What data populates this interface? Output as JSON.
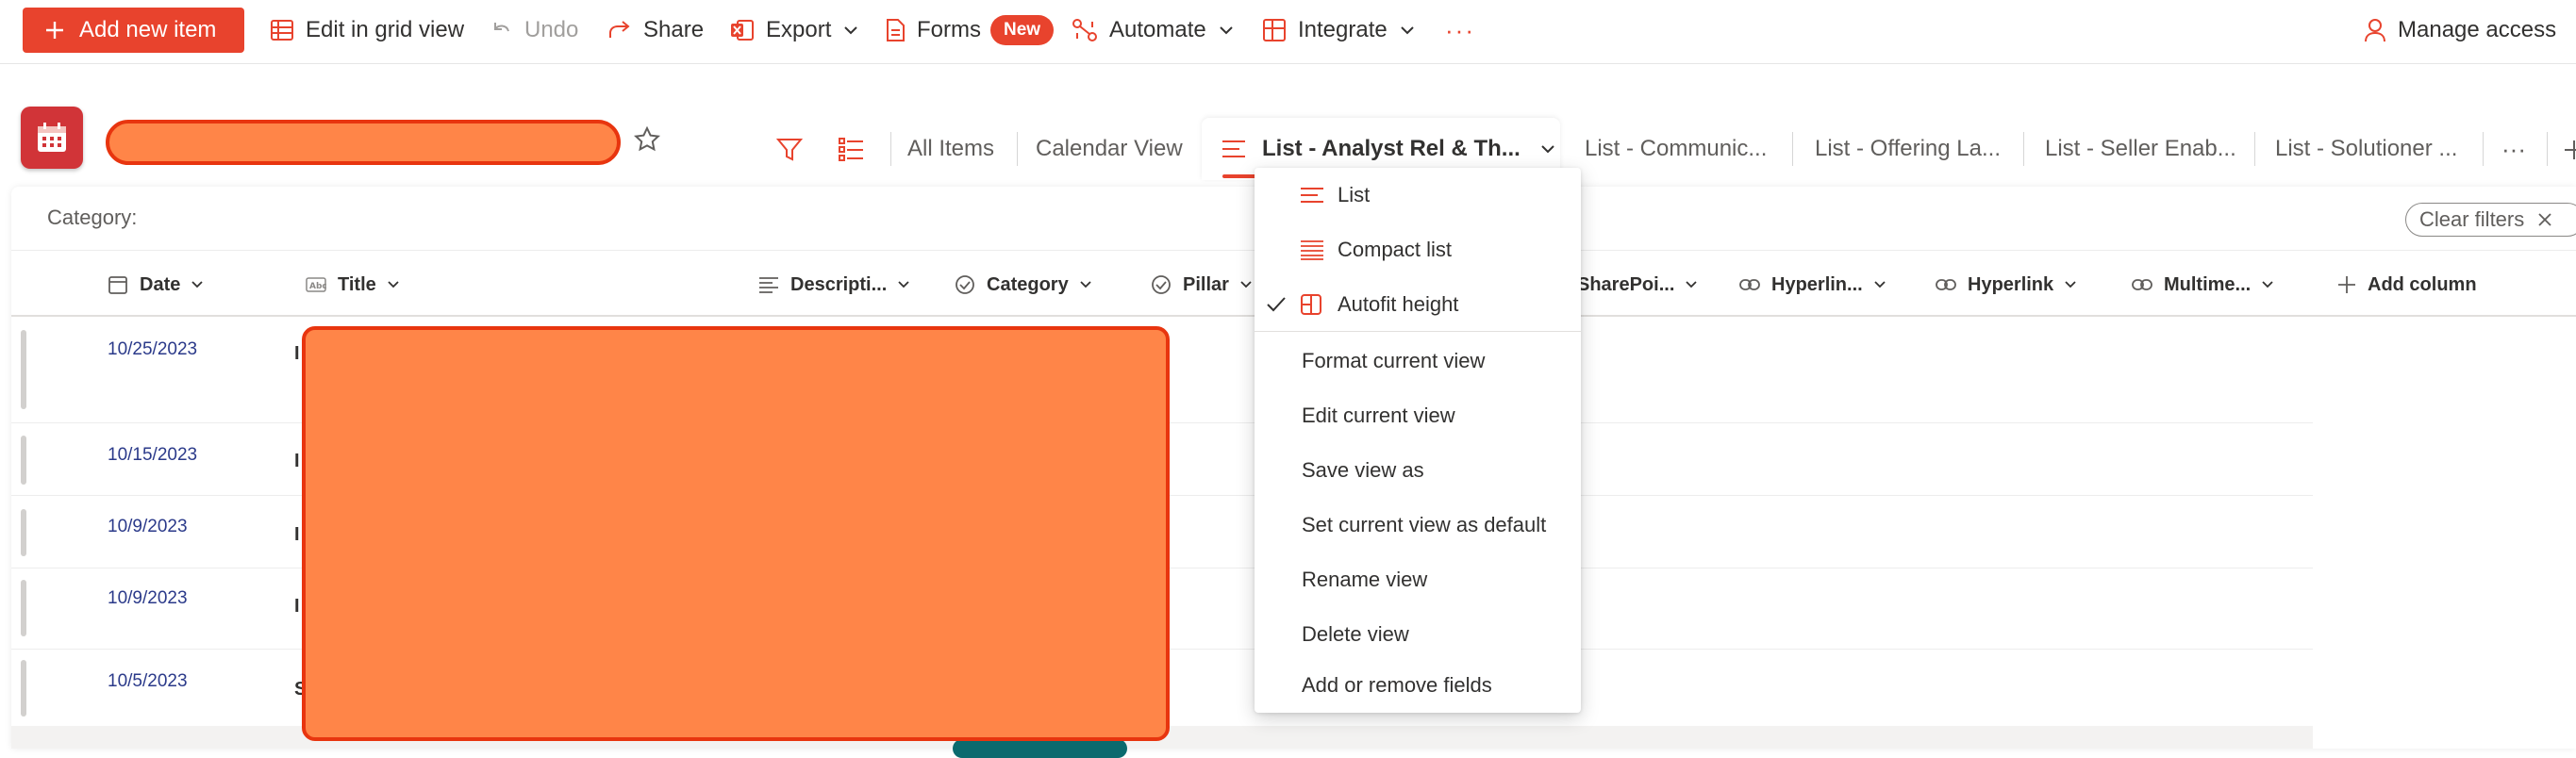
{
  "commandbar": {
    "add_new_item": "Add new item",
    "edit_grid": "Edit in grid view",
    "undo": "Undo",
    "share": "Share",
    "export": "Export",
    "forms": "Forms",
    "forms_badge": "New",
    "automate": "Automate",
    "integrate": "Integrate",
    "more": "···",
    "manage_access": "Manage access"
  },
  "views": {
    "tabs": [
      "All Items",
      "Calendar View",
      "List - Analyst Rel & Th...",
      "List - Communic...",
      "List - Offering La...",
      "List - Seller Enab...",
      "List - Solutioner ..."
    ],
    "more": "···"
  },
  "filter": {
    "category_label": "Category:",
    "clear_filters": "Clear filters"
  },
  "columns": [
    "Date",
    "Title",
    "Descripti...",
    "Category",
    "Pillar",
    "SharePoi...",
    "Hyperlin...",
    "Hyperlink",
    "Multime...",
    "Add column"
  ],
  "rows": [
    {
      "date": "10/25/2023",
      "title_initial": "I"
    },
    {
      "date": "10/15/2023",
      "title_initial": "I"
    },
    {
      "date": "10/9/2023",
      "title_initial": "I"
    },
    {
      "date": "10/9/2023",
      "title_initial": "I"
    },
    {
      "date": "10/5/2023",
      "title_initial": "S"
    }
  ],
  "view_menu": {
    "layout_items": [
      {
        "label": "List",
        "checked": false
      },
      {
        "label": "Compact list",
        "checked": false
      },
      {
        "label": "Autofit height",
        "checked": true
      }
    ],
    "actions": [
      "Format current view",
      "Edit current view",
      "Save view as",
      "Set current view as default",
      "Rename view",
      "Delete view",
      "Add or remove fields"
    ]
  },
  "colors": {
    "accent": "#e8432d",
    "redaction_fill": "#ff8548",
    "redaction_border": "#e8350f",
    "date_text": "#2b3a8a"
  },
  "icons": {
    "add": "plus-icon",
    "grid": "grid-icon",
    "undo": "undo-icon",
    "share": "share-icon",
    "export": "excel-icon",
    "forms": "forms-icon",
    "automate": "flow-icon",
    "integrate": "integrate-icon",
    "manage_access": "person-icon",
    "list": "calendar-list-icon",
    "favorite": "star-icon",
    "filter": "filter-icon",
    "view_options": "view-options-icon"
  }
}
